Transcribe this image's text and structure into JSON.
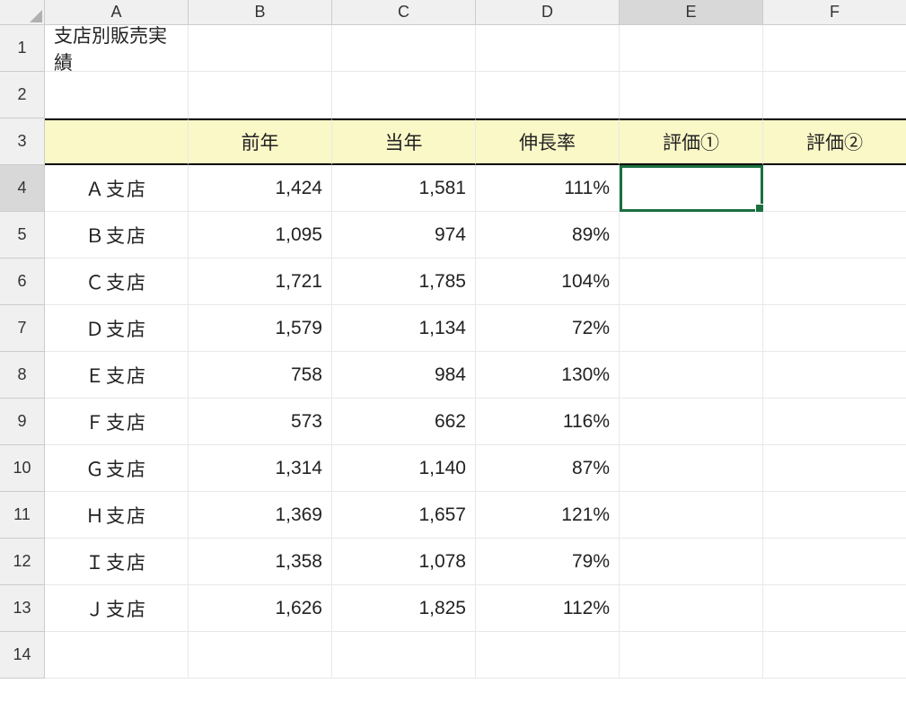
{
  "columns": [
    "A",
    "B",
    "C",
    "D",
    "E",
    "F"
  ],
  "rows": [
    "1",
    "2",
    "3",
    "4",
    "5",
    "6",
    "7",
    "8",
    "9",
    "10",
    "11",
    "12",
    "13",
    "14"
  ],
  "title": "支店別販売実績",
  "headers": {
    "b": "前年",
    "c": "当年",
    "d": "伸長率",
    "e": "評価①",
    "f": "評価②"
  },
  "data": [
    {
      "branch": "Ａ支店",
      "prev": "1,424",
      "curr": "1,581",
      "rate": "111%"
    },
    {
      "branch": "Ｂ支店",
      "prev": "1,095",
      "curr": "974",
      "rate": "89%"
    },
    {
      "branch": "Ｃ支店",
      "prev": "1,721",
      "curr": "1,785",
      "rate": "104%"
    },
    {
      "branch": "Ｄ支店",
      "prev": "1,579",
      "curr": "1,134",
      "rate": "72%"
    },
    {
      "branch": "Ｅ支店",
      "prev": "758",
      "curr": "984",
      "rate": "130%"
    },
    {
      "branch": "Ｆ支店",
      "prev": "573",
      "curr": "662",
      "rate": "116%"
    },
    {
      "branch": "Ｇ支店",
      "prev": "1,314",
      "curr": "1,140",
      "rate": "87%"
    },
    {
      "branch": "Ｈ支店",
      "prev": "1,369",
      "curr": "1,657",
      "rate": "121%"
    },
    {
      "branch": "Ｉ支店",
      "prev": "1,358",
      "curr": "1,078",
      "rate": "79%"
    },
    {
      "branch": "Ｊ支店",
      "prev": "1,626",
      "curr": "1,825",
      "rate": "112%"
    }
  ],
  "active_cell": "E4"
}
